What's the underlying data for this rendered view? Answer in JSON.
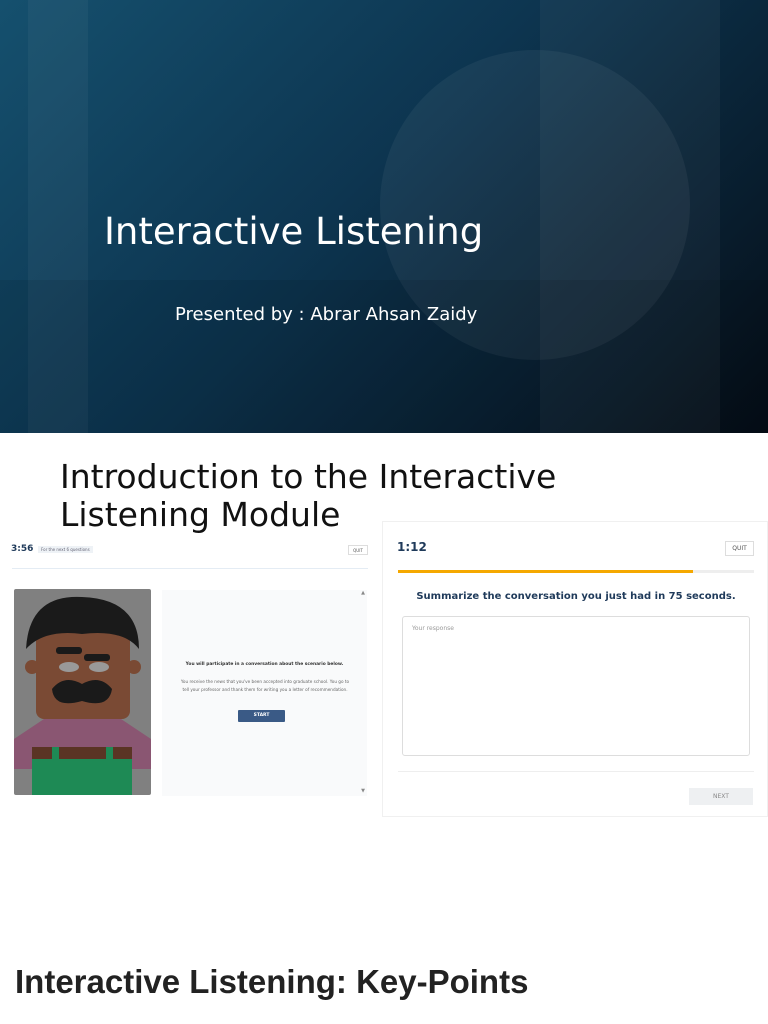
{
  "slide1": {
    "title": "Interactive Listening",
    "subtitle": "Presented by : Abrar Ahsan Zaidy"
  },
  "slide2": {
    "title": "Introduction to the Interactive Listening Module",
    "left_screen": {
      "timer": "3:56",
      "tag": "For the next 6 questions",
      "quit": "QUIT",
      "heading": "You will participate in a conversation about the scenario below.",
      "body": "You receive the news that you've been accepted into graduate school. You go to tell your professor and thank them for writing you a letter of recommendation.",
      "start": "START"
    },
    "right_screen": {
      "timer": "1:12",
      "quit": "QUIT",
      "progress": 0.83,
      "prompt": "Summarize the conversation you just had in 75 seconds.",
      "placeholder": "Your response",
      "next": "NEXT"
    },
    "colors": {
      "progress": "#f5a800",
      "start_button": "#3a5a86"
    }
  },
  "slide3": {
    "title": "Interactive Listening: Key-Points"
  }
}
